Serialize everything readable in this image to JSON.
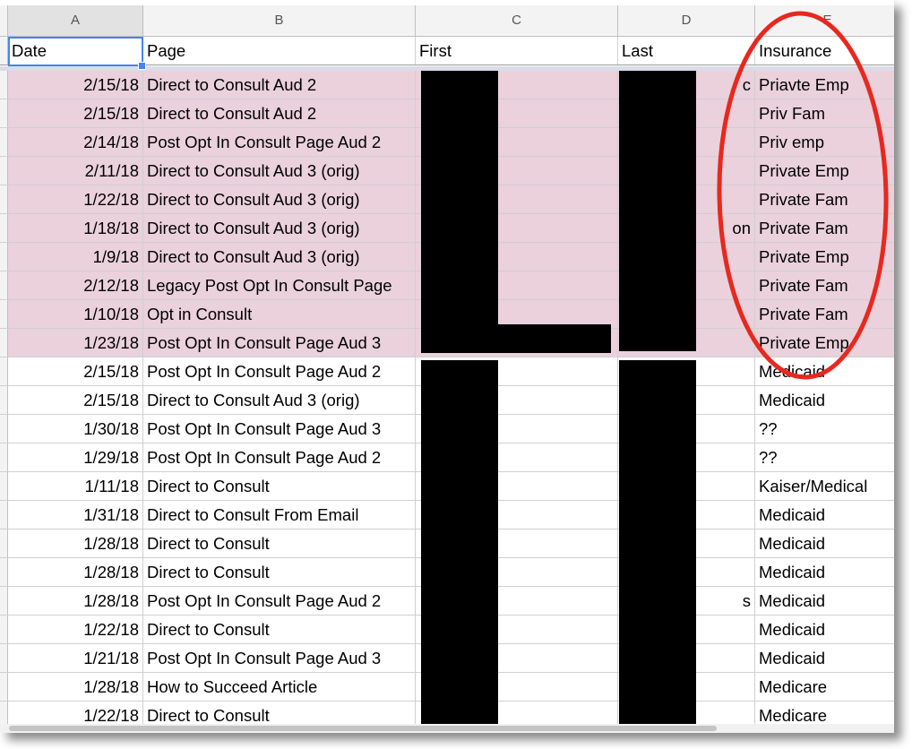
{
  "columns": [
    "A",
    "B",
    "C",
    "D",
    "E"
  ],
  "header": {
    "date": "Date",
    "page": "Page",
    "first": "First",
    "last": "Last",
    "insurance": "Insurance"
  },
  "rows": [
    {
      "date": "2/15/18",
      "page": "Direct to Consult Aud 2",
      "first": "",
      "last": "c",
      "insurance": "Priavte Emp"
    },
    {
      "date": "2/15/18",
      "page": "Direct to Consult Aud 2",
      "first": "",
      "last": "",
      "insurance": "Priv Fam"
    },
    {
      "date": "2/14/18",
      "page": "Post Opt In Consult Page Aud 2",
      "first": "",
      "last": "",
      "insurance": "Priv emp"
    },
    {
      "date": "2/11/18",
      "page": "Direct to Consult Aud 3 (orig)",
      "first": "",
      "last": "",
      "insurance": "Private Emp"
    },
    {
      "date": "1/22/18",
      "page": "Direct to Consult Aud 3 (orig)",
      "first": "",
      "last": "",
      "insurance": "Private Fam"
    },
    {
      "date": "1/18/18",
      "page": "Direct to Consult Aud 3 (orig)",
      "first": "",
      "last": "on",
      "insurance": "Private Fam"
    },
    {
      "date": "1/9/18",
      "page": "Direct to Consult Aud 3 (orig)",
      "first": "",
      "last": "",
      "insurance": "Private Emp"
    },
    {
      "date": "2/12/18",
      "page": "Legacy Post Opt In Consult Page",
      "first": "",
      "last": "",
      "insurance": "Private Fam"
    },
    {
      "date": "1/10/18",
      "page": "Opt in Consult",
      "first": "",
      "last": "",
      "insurance": "Private Fam"
    },
    {
      "date": "1/23/18",
      "page": "Post Opt In Consult Page Aud 3",
      "first": "",
      "last": "",
      "insurance": "Private Emp"
    },
    {
      "date": "2/15/18",
      "page": "Post Opt In Consult Page Aud 2",
      "first": "",
      "last": "",
      "insurance": "Medicaid"
    },
    {
      "date": "2/15/18",
      "page": "Direct to Consult Aud 3 (orig)",
      "first": "",
      "last": "",
      "insurance": "Medicaid"
    },
    {
      "date": "1/30/18",
      "page": "Post Opt In Consult Page Aud 3",
      "first": "",
      "last": "",
      "insurance": "??"
    },
    {
      "date": "1/29/18",
      "page": "Post Opt In Consult Page Aud 2",
      "first": "",
      "last": "",
      "insurance": "??"
    },
    {
      "date": "1/11/18",
      "page": "Direct to Consult",
      "first": "",
      "last": "",
      "insurance": "Kaiser/Medical"
    },
    {
      "date": "1/31/18",
      "page": "Direct to Consult From Email",
      "first": "",
      "last": "",
      "insurance": "Medicaid"
    },
    {
      "date": "1/28/18",
      "page": "Direct to Consult",
      "first": "",
      "last": "",
      "insurance": "Medicaid"
    },
    {
      "date": "1/28/18",
      "page": "Direct to Consult",
      "first": "",
      "last": "",
      "insurance": "Medicaid"
    },
    {
      "date": "1/28/18",
      "page": "Post Opt In Consult Page Aud 2",
      "first": "",
      "last": "s",
      "insurance": "Medicaid"
    },
    {
      "date": "1/22/18",
      "page": "Direct to Consult",
      "first": "",
      "last": "",
      "insurance": "Medicaid"
    },
    {
      "date": "1/21/18",
      "page": "Post Opt In Consult Page Aud 3",
      "first": "",
      "last": "",
      "insurance": "Medicaid"
    },
    {
      "date": "1/28/18",
      "page": "How to Succeed Article",
      "first": "",
      "last": "",
      "insurance": "Medicare"
    },
    {
      "date": "1/22/18",
      "page": "Direct to Consult",
      "first": "",
      "last": "",
      "insurance": "Medicare"
    }
  ],
  "colors": {
    "highlight_row": "#ead1dc",
    "selection": "#4285f4",
    "annotation": "#e8281e",
    "redaction": "#000000"
  }
}
